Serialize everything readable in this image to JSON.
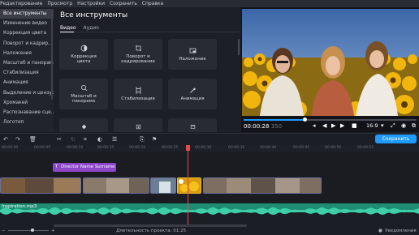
{
  "menu": [
    "Редактирование",
    "Просмотр",
    "Настройки",
    "Сохранить",
    "Справка"
  ],
  "sidebar": {
    "items": [
      {
        "label": "Все инструменты",
        "active": true
      },
      {
        "label": "Изменение видео"
      },
      {
        "label": "Коррекция цвета"
      },
      {
        "label": "Поворот и кадрир..."
      },
      {
        "label": "Наложение"
      },
      {
        "label": "Масштаб и панорамa"
      },
      {
        "label": "Стабилизация"
      },
      {
        "label": "Анимация"
      },
      {
        "label": "Выделение и цензура"
      },
      {
        "label": "Хромакей"
      },
      {
        "label": "Распознавание сце..."
      },
      {
        "label": "Логотип"
      }
    ]
  },
  "panel": {
    "title": "Все инструменты",
    "tabs": [
      {
        "label": "Видео",
        "active": true
      },
      {
        "label": "Аудио"
      }
    ],
    "tiles": [
      {
        "label": "Коррекция\nцвета",
        "icon": "color-correction-icon"
      },
      {
        "label": "Поворот и\nкадрирование",
        "icon": "crop-rotate-icon"
      },
      {
        "label": "Наложение",
        "icon": "overlay-icon"
      },
      {
        "label": "Масштаб и\nпанорама",
        "icon": "zoom-pan-icon"
      },
      {
        "label": "Стабилизация",
        "icon": "stabilization-icon"
      },
      {
        "label": "Анимация",
        "icon": "animation-icon"
      },
      {
        "label": "",
        "icon": "highlight-icon"
      },
      {
        "label": "",
        "icon": "chroma-icon"
      },
      {
        "label": "",
        "icon": "scene-icon"
      }
    ]
  },
  "player": {
    "timecode": "00:00:28",
    "timecode_frames": "350",
    "progress": 0.35,
    "aspect": "16:9"
  },
  "toolbar": {
    "save_label": "Сохранить"
  },
  "ruler": [
    "00:00:00",
    "00:00:05",
    "00:00:10",
    "00:00:15",
    "00:00:20",
    "00:00:25",
    "00:00:30",
    "00:00:35",
    "00:00:40",
    "00:00:45",
    "00:00:50",
    "00:00:55"
  ],
  "timeline": {
    "title_clip": "Director Name Surname",
    "audio_clip": "Inspiration.mp3"
  },
  "status": {
    "duration_label": "Длительность проекта: 01:25",
    "notifications": "Уведомления"
  },
  "colors": {
    "accent": "#1f9bff",
    "title_clip": "#8e46c9",
    "audio": "#1f8d73",
    "playhead": "#e34a4a"
  }
}
